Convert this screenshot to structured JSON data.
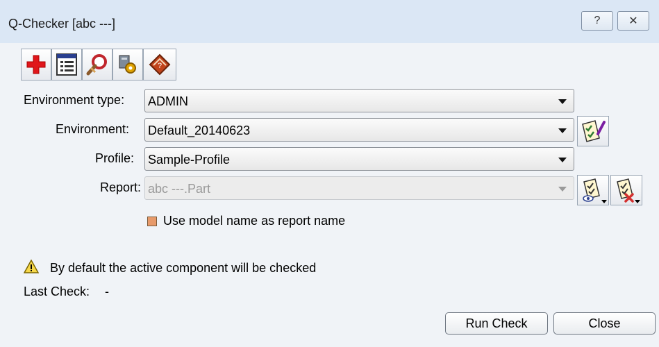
{
  "window": {
    "title": "Q-Checker [abc ---]",
    "help_label": "?",
    "close_label": "✕"
  },
  "toolbar": {
    "icons": [
      "add-icon",
      "list-window-icon",
      "search-magnifier-icon",
      "settings-gear-icon",
      "help-book-icon"
    ]
  },
  "form": {
    "environment_type": {
      "label": "Environment type:",
      "value": "ADMIN"
    },
    "environment": {
      "label": "Environment:",
      "value": "Default_20140623"
    },
    "profile": {
      "label": "Profile:",
      "value": "Sample-Profile"
    },
    "report": {
      "label": "Report:",
      "value": "abc ---.Part"
    },
    "use_model_name_label": "Use model name as report name",
    "use_model_name_checked": true
  },
  "info": {
    "message": "By default the active component will be checked",
    "last_check_label": "Last Check:",
    "last_check_value": "-"
  },
  "buttons": {
    "run_check": "Run Check",
    "close": "Close"
  },
  "colors": {
    "titlebar": "#dbe7f5",
    "body": "#f0f3f7",
    "checkbox_fill": "#e79a6b"
  }
}
